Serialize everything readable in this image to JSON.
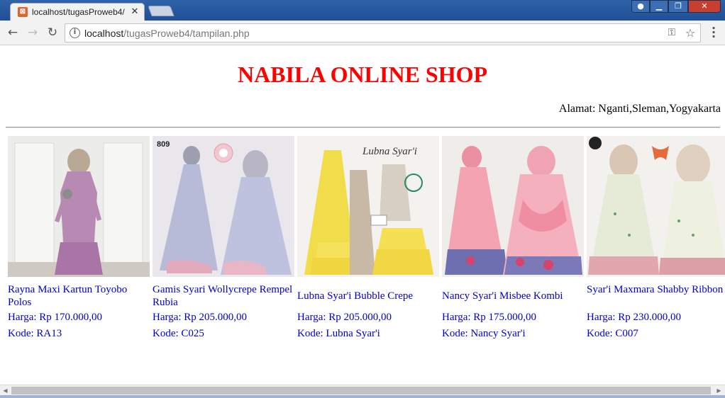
{
  "browser": {
    "tab_title": "localhost/tugasProweb4/",
    "favicon_glyph": "⊠",
    "close_glyph": "✕",
    "url_host": "localhost",
    "url_path": "/tugasProweb4/tampilan.php",
    "icons": {
      "back": "back-arrow-icon",
      "forward": "forward-arrow-icon",
      "reload": "reload-icon",
      "info": "info-icon",
      "key": "key-icon",
      "star": "star-icon",
      "menu": "kebab-menu-icon"
    },
    "colors": {
      "titlebar": "#2f62a8",
      "close_button": "#c7402f"
    }
  },
  "page": {
    "title": "NABILA ONLINE SHOP",
    "title_color": "#ff0000",
    "address": "Alamat: Nganti,Sleman,Yogyakarta",
    "link_color": "#0000cc"
  },
  "products": [
    {
      "name": "Rayna Maxi Kartun Toyobo Polos",
      "price": "Harga: Rp 170.000,00",
      "code": "Kode: RA13"
    },
    {
      "name": "Gamis Syari Wollycrepe Rempel Rubia",
      "price": "Harga: Rp 205.000,00",
      "code": "Kode: C025",
      "photo_label": "809"
    },
    {
      "name": "Lubna Syar'i Bubble Crepe",
      "price": "Harga: Rp 205.000,00",
      "code": "Kode: Lubna Syar'i",
      "photo_label": "Lubna Syar'i"
    },
    {
      "name": "Nancy Syar'i Misbee Kombi",
      "price": "Harga: Rp 175.000,00",
      "code": "Kode: Nancy Syar'i"
    },
    {
      "name": "Syar'i Maxmara Shabby Ribbon",
      "price": "Harga: Rp 230.000,00",
      "code": "Kode: C007"
    }
  ]
}
